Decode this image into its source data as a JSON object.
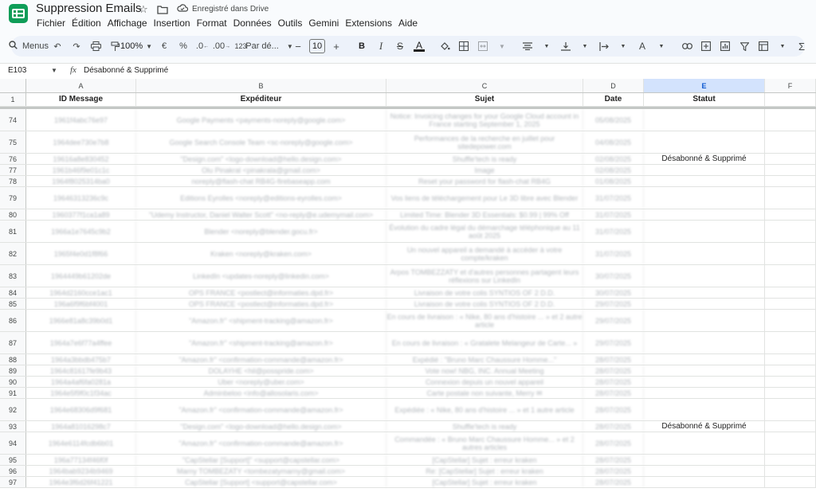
{
  "app": {
    "title": "Suppression Emails",
    "saved_status": "Enregistré dans Drive",
    "colors": {
      "brand": "#0f9d58",
      "accent": "#0b57d0"
    }
  },
  "menu": [
    "Fichier",
    "Édition",
    "Affichage",
    "Insertion",
    "Format",
    "Données",
    "Outils",
    "Gemini",
    "Extensions",
    "Aide"
  ],
  "toolbar": {
    "search_label": "Menus",
    "zoom": "100%",
    "currency": "€",
    "percent": "%",
    "dec_decrease": ".0",
    "dec_increase": ".00",
    "number_format": "123",
    "font": "Par dé...",
    "font_size": "10",
    "minus": "−",
    "plus": "+",
    "bold": "B",
    "italic": "I",
    "strike": "S",
    "text_color": "A",
    "text_rotate": "A"
  },
  "formula_bar": {
    "cell_ref": "E103",
    "fx": "fx",
    "value": "Désabonné & Supprimé"
  },
  "columns": [
    "A",
    "B",
    "C",
    "D",
    "E",
    "F"
  ],
  "selected_column": "E",
  "header_row": {
    "num": "1",
    "cells": [
      "ID Message",
      "Expéditeur",
      "Sujet",
      "Date",
      "Statut",
      ""
    ]
  },
  "rows": [
    {
      "num": "74",
      "a": "1961f4abc76e97",
      "b": "Google Payments <payments-noreply@google.com>",
      "c": "Notice: Invoicing changes for your Google Cloud account in France starting September 1, 2025",
      "d": "05/08/2025",
      "e": ""
    },
    {
      "num": "75",
      "a": "1964dee730e7b8",
      "b": "Google Search Console Team <sc-noreply@google.com>",
      "c": "Performances de la recherche en juillet pour sitedepower.com",
      "d": "04/08/2025",
      "e": ""
    },
    {
      "num": "76",
      "a": "19616a8e830452",
      "b": "\"Design.com\" <logo-download@hello.design.com>",
      "c": "Shuffle'tech is ready",
      "d": "02/08/2025",
      "e": "Désabonné & Supprimé"
    },
    {
      "num": "77",
      "a": "1961b46f9e01c1c",
      "b": "Olu Pinakral <pinakrala@gmail.com>",
      "c": "Image",
      "d": "02/08/2025",
      "e": ""
    },
    {
      "num": "78",
      "a": "1964f8025314ba0",
      "b": "noreply@flash-chat RB4G-firebaseapp.com",
      "c": "Reset your password for flash-chat RB4G",
      "d": "01/08/2025",
      "e": ""
    },
    {
      "num": "79",
      "a": "19646313236c9c",
      "b": "Editions Eyrolles <noreply@editions-eyrolles.com>",
      "c": "Vos liens de téléchargement pour Le 3D libre avec Blender",
      "d": "31/07/2025",
      "e": ""
    },
    {
      "num": "80",
      "a": "1960377f1ca1a89",
      "b": "\"Udemy Instructor, Daniel Walter Scott\" <no-reply@e.udemymail.com>",
      "c": "Limited Time: Blender 3D Essentials: $0.99 | 99% Off",
      "d": "31/07/2025",
      "e": ""
    },
    {
      "num": "81",
      "a": "1966a1e7645c9b2",
      "b": "Blender <noreply@blender.gocu.fr>",
      "c": "Évolution du cadre légal du démarchage téléphonique au 11 août 2025",
      "d": "31/07/2025",
      "e": ""
    },
    {
      "num": "82",
      "a": "1965f4e0d1f8f66",
      "b": "Kraken <noreply@kraken.com>",
      "c": "Un nouvel appareil a demandé à accéder à votre compte/kraken",
      "d": "31/07/2025",
      "e": ""
    },
    {
      "num": "83",
      "a": "1964449b61202de",
      "b": "LinkedIn <updates-noreply@linkedin.com>",
      "c": "Arpos TOMBEZZATY et d'autres personnes partagent leurs réflexions sur LinkedIn",
      "d": "30/07/2025",
      "e": ""
    },
    {
      "num": "84",
      "a": "1964d2160cce1ac1",
      "b": "OPS FRANCE <postlect@informaties.dpd.fr>",
      "c": "Livraison de votre colis SYNTIOS OF 2 D.D.",
      "d": "30/07/2025",
      "e": ""
    },
    {
      "num": "85",
      "a": "196a6f9f6bf4001",
      "b": "OPS FRANCE <postlect@informaties.dpd.fr>",
      "c": "Livraison de votre colis SYNTIOS OF 2 D.D.",
      "d": "29/07/2025",
      "e": ""
    },
    {
      "num": "86",
      "a": "1966e81a8c39b0d1",
      "b": "\"Amazon.fr\" <shipment-tracking@amazon.fr>",
      "c": "En cours de livraison : « Nike, 80 ans d'histoire ... » et 2 autre article",
      "d": "29/07/2025",
      "e": ""
    },
    {
      "num": "87",
      "a": "1964a7e6f77a4ffee",
      "b": "\"Amazon.fr\" <shipment-tracking@amazon.fr>",
      "c": "En cours de livraison : « Gratalete Melangeur de Carte... »",
      "d": "29/07/2025",
      "e": ""
    },
    {
      "num": "88",
      "a": "1964a3bbdb475b7",
      "b": "\"Amazon.fr\" <confirmation-commande@amazon.fr>",
      "c": "Expédié : \"Bruno Marc Chaussure Homme...\"",
      "d": "28/07/2025",
      "e": ""
    },
    {
      "num": "89",
      "a": "1964c81617fe9b43",
      "b": "DOLAYHE <hil@posspride.com>",
      "c": "Vote now! NBG, INC. Annual Meeting",
      "d": "28/07/2025",
      "e": ""
    },
    {
      "num": "90",
      "a": "1964a4af6fa0281a",
      "b": "Uber <noreply@uber.com>",
      "c": "Connexion depuis un nouvel appareil",
      "d": "28/07/2025",
      "e": ""
    },
    {
      "num": "91",
      "a": "1964e5f9f0c1f34ac",
      "b": "Adminbeloo <info@allosolaris.com>",
      "c": "Carte postale non suivante, Merry ✉",
      "d": "28/07/2025",
      "e": ""
    },
    {
      "num": "92",
      "a": "1964e68306d9f681",
      "b": "\"Amazon.fr\" <confirmation-commande@amazon.fr>",
      "c": "Expédiée : « Nike, 80 ans d'histoire ... » et 1 autre article",
      "d": "28/07/2025",
      "e": ""
    },
    {
      "num": "93",
      "a": "1964a81016298c7",
      "b": "\"Design.com\" <logo-download@hello.design.com>",
      "c": "Shuffle'tech is ready",
      "d": "28/07/2025",
      "e": "Désabonné & Supprimé"
    },
    {
      "num": "94",
      "a": "1964e6114fcdb6b01",
      "b": "\"Amazon.fr\" <confirmation-commande@amazon.fr>",
      "c": "Commandée : « Bruno Marc Chaussure Homme... » et 2 autres articles",
      "d": "28/07/2025",
      "e": ""
    },
    {
      "num": "95",
      "a": "196a77134f46f0f",
      "b": "\"CapStellar [Support]\" <support@capstellar.com>",
      "c": "[CapStellar] Sujet : erreur kraken",
      "d": "28/07/2025",
      "e": ""
    },
    {
      "num": "96",
      "a": "1964bab9234b9469",
      "b": "Marny TOMBEZATY <tombezatymarny@gmail.com>",
      "c": "Re: [CapStellar] Sujet : erreur kraken",
      "d": "28/07/2025",
      "e": ""
    },
    {
      "num": "97",
      "a": "1964e3f6d26f41221",
      "b": "CapStellar [Support] <support@capstellar.com>",
      "c": "[CapStellar] Sujet : erreur kraken",
      "d": "28/07/2025",
      "e": ""
    }
  ]
}
